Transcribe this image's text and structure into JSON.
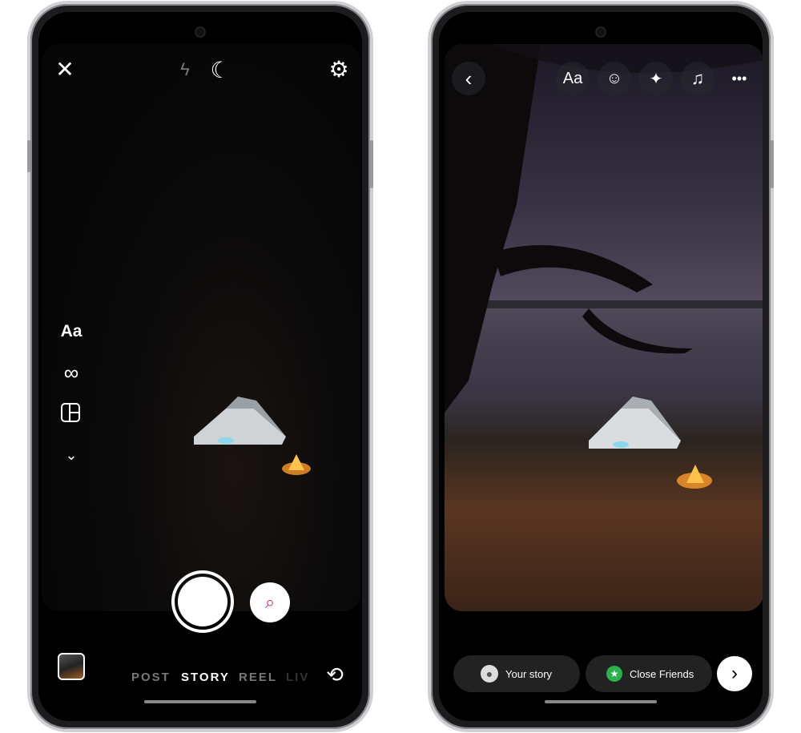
{
  "left": {
    "top_icons": [
      "close-icon",
      "flash-off-icon",
      "night-mode-icon",
      "settings-icon"
    ],
    "side_tools": {
      "text_label": "Aa",
      "icons": [
        "boomerang-icon",
        "layout-icon",
        "chevron-down-icon"
      ]
    },
    "modes": [
      {
        "label": "POST"
      },
      {
        "label": "STORY",
        "active": true
      },
      {
        "label": "REEL"
      },
      {
        "label": "LIV"
      }
    ]
  },
  "right": {
    "toolbar": {
      "text_label": "Aa",
      "icons": [
        "back-icon",
        "sticker-icon",
        "effects-icon",
        "music-icon",
        "more-icon"
      ]
    },
    "your_story": "Your story",
    "close_friends": "Close Friends",
    "close_friends_color": "#2bb24c"
  }
}
